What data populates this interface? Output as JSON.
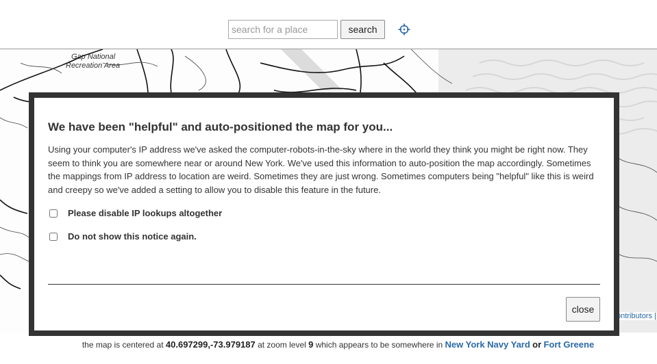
{
  "search": {
    "placeholder": "search for a place",
    "button_label": "search"
  },
  "map": {
    "labels": [
      "Gap National",
      "Recreation Area"
    ],
    "attribution": "ontributors |"
  },
  "modal": {
    "title": "We have been \"helpful\" and auto-positioned the map for you...",
    "body": "Using your computer's IP address we've asked the computer-robots-in-the-sky where in the world they think you might be right now. They seem to think you are somewhere near or around New York. We've used this information to auto-position the map accordingly. Sometimes the mappings from IP address to location are weird. Sometimes they are just wrong. Sometimes computers being \"helpful\" like this is weird and creepy so we've added a setting to allow you to disable this feature in the future.",
    "options": [
      {
        "label": "Please disable IP lookups altogether",
        "checked": false
      },
      {
        "label": "Do not show this notice again.",
        "checked": false
      }
    ],
    "close_label": "close"
  },
  "footer": {
    "prefix": "the map is centered at",
    "coords": "40.697299,-73.979187",
    "zoom_text": "at zoom level",
    "zoom": "9",
    "middle": "which appears to be somewhere in",
    "place1": "New York Navy Yard",
    "or": "or",
    "place2": "Fort Greene"
  },
  "colors": {
    "modal_border": "#333333",
    "link": "#2a6aa8"
  }
}
